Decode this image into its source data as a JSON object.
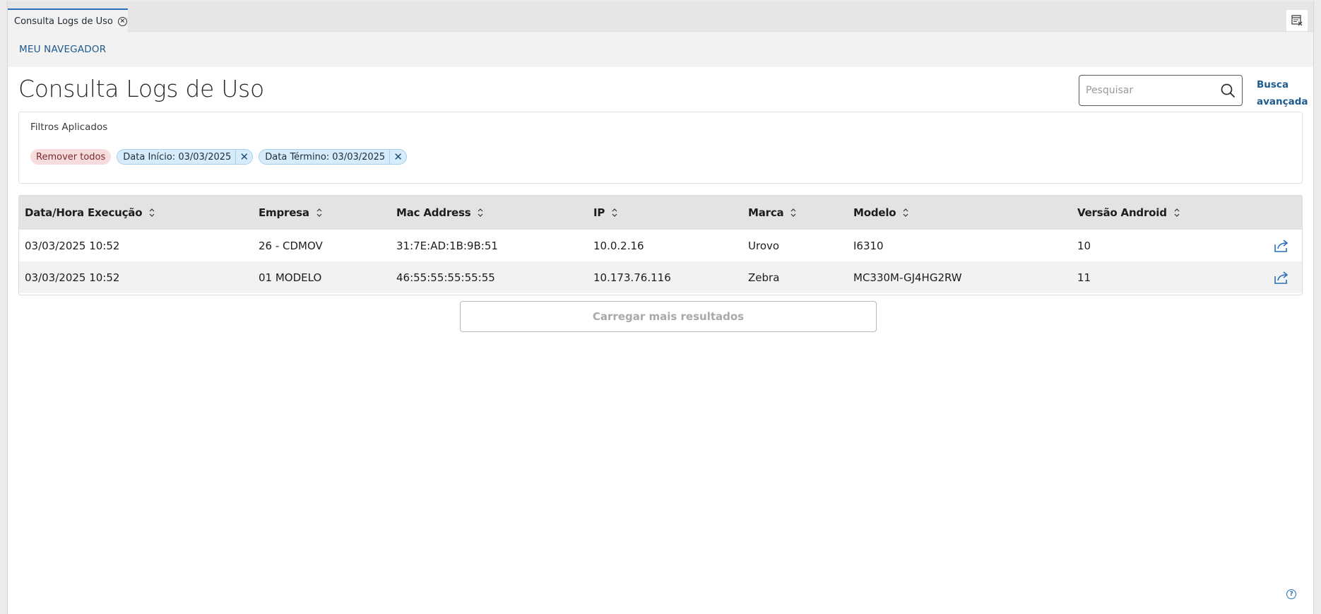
{
  "tab": {
    "label": "Consulta Logs de Uso"
  },
  "breadcrumb": {
    "label": "MEU NAVEGADOR"
  },
  "header": {
    "title": "Consulta Logs de Uso",
    "search_placeholder": "Pesquisar",
    "advanced_search_line1": "Busca",
    "advanced_search_line2": "avançada"
  },
  "filters": {
    "title": "Filtros Aplicados",
    "remove_all": "Remover todos",
    "chips": [
      {
        "label": "Data Início: 03/03/2025"
      },
      {
        "label": "Data Término: 03/03/2025"
      }
    ]
  },
  "table": {
    "columns": [
      "Data/Hora Execução",
      "Empresa",
      "Mac Address",
      "IP",
      "Marca",
      "Modelo",
      "Versão Android"
    ],
    "rows": [
      [
        "03/03/2025 10:52",
        "26 - CDMOV",
        "31:7E:AD:1B:9B:51",
        "10.0.2.16",
        "Urovo",
        "I6310",
        "10"
      ],
      [
        "03/03/2025 10:52",
        "01 MODELO",
        "46:55:55:55:55:55",
        "10.173.76.116",
        "Zebra",
        "MC330M-GJ4HG2RW",
        "11"
      ]
    ]
  },
  "load_more": {
    "label": "Carregar mais resultados"
  },
  "colors": {
    "accent": "#2b6eb5",
    "link": "#1d5a8e",
    "chip_remove_bg": "#f6dcdc",
    "chip_filter_bg": "#d6ecfa"
  },
  "icons": [
    "close-circle-icon",
    "window-tools-icon",
    "search-icon",
    "sort-icon",
    "share-icon",
    "help-icon"
  ]
}
